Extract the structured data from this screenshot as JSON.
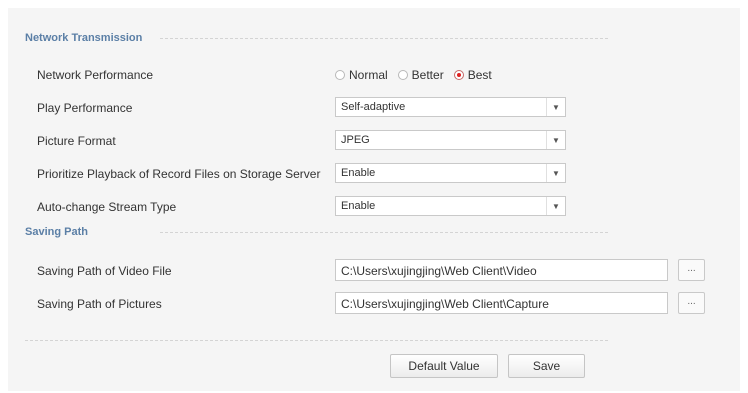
{
  "sections": {
    "network": {
      "title": "Network Transmission"
    },
    "saving": {
      "title": "Saving Path"
    }
  },
  "network_performance": {
    "label": "Network Performance",
    "options": [
      {
        "label": "Normal",
        "checked": false
      },
      {
        "label": "Better",
        "checked": false
      },
      {
        "label": "Best",
        "checked": true
      }
    ]
  },
  "play_performance": {
    "label": "Play Performance",
    "value": "Self-adaptive"
  },
  "picture_format": {
    "label": "Picture Format",
    "value": "JPEG"
  },
  "prioritize_playback": {
    "label": "Prioritize Playback of Record Files on Storage Server",
    "value": "Enable"
  },
  "auto_change_stream": {
    "label": "Auto-change Stream Type",
    "value": "Enable"
  },
  "video_path": {
    "label": "Saving Path of Video File",
    "value": "C:\\Users\\xujingjing\\Web Client\\Video",
    "browse_label": "..."
  },
  "picture_path": {
    "label": "Saving Path of Pictures",
    "value": "C:\\Users\\xujingjing\\Web Client\\Capture",
    "browse_label": "..."
  },
  "buttons": {
    "default_value": "Default Value",
    "save": "Save"
  },
  "colors": {
    "section_title": "#5b7fa6",
    "panel_bg": "#f5f5f5",
    "radio_checked": "#e02020"
  }
}
